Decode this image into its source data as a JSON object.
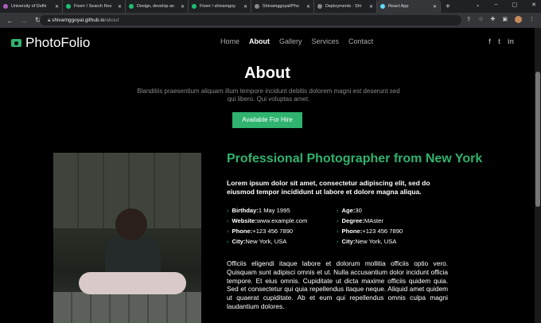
{
  "browser": {
    "tabs": [
      {
        "label": "University of Delhi",
        "color": "#b05cc0"
      },
      {
        "label": "Fiverr / Search Res",
        "color": "#1dbf73"
      },
      {
        "label": "Design, develop an",
        "color": "#1dbf73"
      },
      {
        "label": "Fiverr / shivamgoy",
        "color": "#1dbf73"
      },
      {
        "label": "Shivamggoyal/Pho",
        "color": "#888888"
      },
      {
        "label": "Deployments · Shi",
        "color": "#888888"
      },
      {
        "label": "React App",
        "color": "#61dafb"
      }
    ],
    "url_host": "shivamggoyal.github.io",
    "url_path": "/about"
  },
  "header": {
    "logo": "PhotoFolio",
    "nav": [
      "Home",
      "About",
      "Gallery",
      "Services",
      "Contact"
    ],
    "active": "About",
    "social": [
      "f",
      "t",
      "in"
    ]
  },
  "hero": {
    "title": "About",
    "subtitle": "Blanditiis praesentium aliquam illum tempore incidunt debitis dolorem magni est deserunt sed qui libero. Qui voluptas amet.",
    "button": "Available For Hire"
  },
  "about": {
    "heading": "Professional Photographer from New York",
    "intro": "Lorem ipsum dolor sit amet, consectetur adipiscing elit, sed do eiusmod tempor incididunt ut labore et dolore magna aliqua.",
    "details": [
      {
        "k": "Birthday:",
        "v": "1 May 1995"
      },
      {
        "k": "Age:",
        "v": "30"
      },
      {
        "k": "Website:",
        "v": "www.example.com"
      },
      {
        "k": "Degree:",
        "v": "MAster"
      },
      {
        "k": "Phone:",
        "v": "+123 456 7890"
      },
      {
        "k": "Phone:",
        "v": "+123 456 7890"
      },
      {
        "k": "City:",
        "v": "New York, USA"
      },
      {
        "k": "City:",
        "v": "New York, USA"
      }
    ],
    "paragraph": "Officiis eligendi itaque labore et dolorum mollitia officiis optio vero. Quisquam sunt adipisci omnis et ut. Nulla accusantium dolor incidunt officia tempore. Et eius omnis. Cupiditate ut dicta maxime officiis quidem quia. Sed et consectetur qui quia repellendus itaque neque. Aliquid amet quidem ut quaerat cupiditate. Ab et eum qui repellendus omnis culpa magni laudantium dolores."
  },
  "colors": {
    "accent": "#2fb36f"
  }
}
